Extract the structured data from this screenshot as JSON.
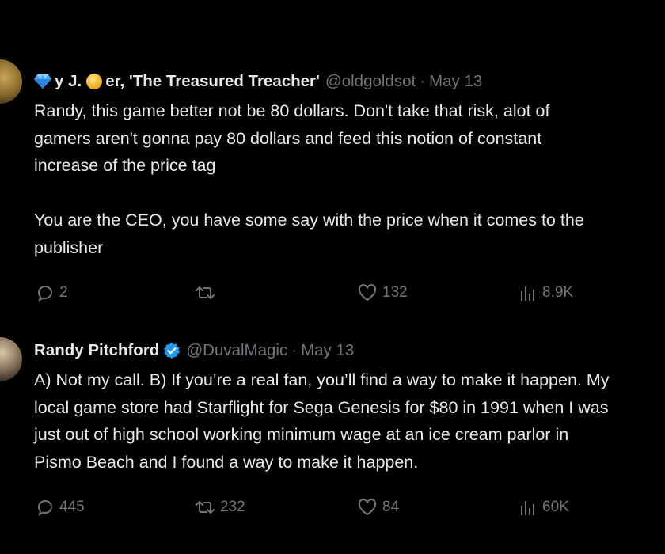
{
  "tweets": [
    {
      "name_part1": "y J.",
      "name_part2": "er, 'The Treasured Treacher'",
      "handle": "@oldgoldsot",
      "separator": "·",
      "date": "May 13",
      "lines": [
        "Randy, this game better not be 80 dollars. Don't take that risk, alot of",
        "gamers aren't gonna pay 80 dollars and feed this notion of constant",
        "increase of the price tag",
        "",
        "You are the CEO, you have some say with the price when it comes to the",
        "publisher"
      ],
      "replies": "2",
      "reposts": "",
      "likes": "132",
      "views": "8.9K"
    },
    {
      "name": "Randy Pitchford",
      "handle": "@DuvalMagic",
      "separator": "·",
      "date": "May 13",
      "lines": [
        "A) Not my call. B) If you’re a real fan, you’ll find a way to make it happen. My",
        "local game store had Starflight for Sega Genesis for $80 in 1991 when I was",
        "just out of high school working minimum wage at an ice cream parlor in",
        "Pismo Beach and I found a way to make it happen."
      ],
      "replies": "445",
      "reposts": "232",
      "likes": "84",
      "views": "60K"
    }
  ],
  "icons": {
    "reply": "reply-icon",
    "repost": "repost-icon",
    "like": "heart-icon",
    "views": "views-icon",
    "verified": "verified-badge-icon",
    "gem": "gem-emoji-icon",
    "medal": "medal-emoji-icon"
  },
  "colors": {
    "background": "#000000",
    "text": "#e7e9ea",
    "muted": "#71767b",
    "verified": "#1d9bf0",
    "gem": "#4aa8ff",
    "medal": "#f2b01e"
  }
}
